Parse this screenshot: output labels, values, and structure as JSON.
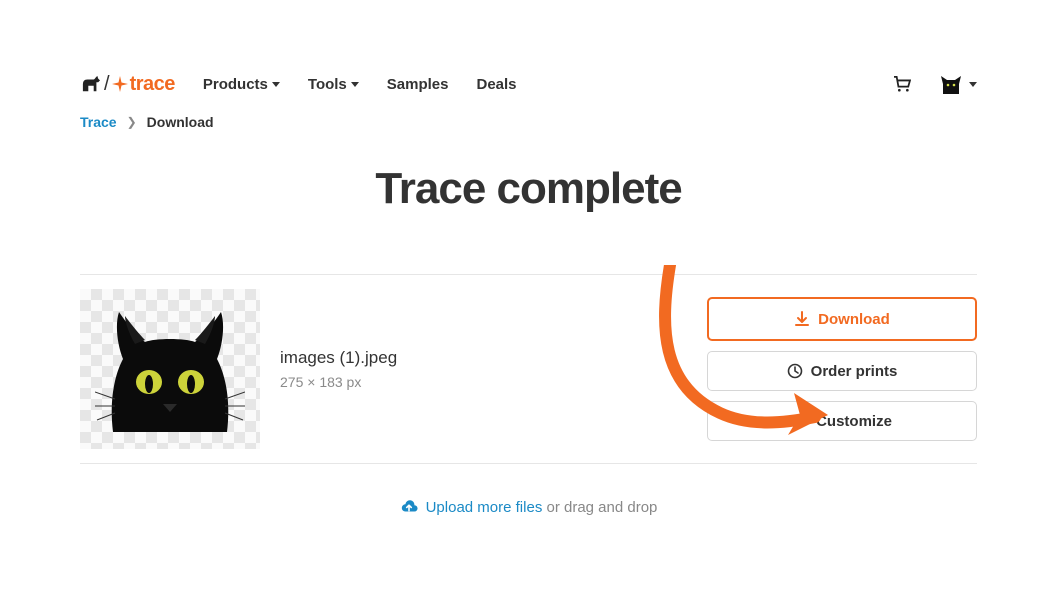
{
  "brand": {
    "word": "trace",
    "accent": "#f26a21",
    "link_color": "#1b8ac6"
  },
  "nav": {
    "products": "Products",
    "tools": "Tools",
    "samples": "Samples",
    "deals": "Deals"
  },
  "breadcrumb": {
    "root": "Trace",
    "current": "Download"
  },
  "page": {
    "title": "Trace complete"
  },
  "file": {
    "name": "images (1).jpeg",
    "dimensions": "275 × 183 px",
    "subject": "black-cat"
  },
  "actions": {
    "download": "Download",
    "order_prints": "Order prints",
    "customize": "Customize"
  },
  "upload": {
    "link_text": "Upload more files",
    "suffix": " or drag and drop"
  },
  "annotation": {
    "type": "curved-arrow",
    "color": "#f26a21",
    "points_to": "customize-button"
  }
}
